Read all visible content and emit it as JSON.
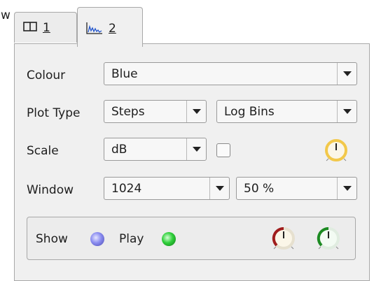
{
  "edge_text": "w",
  "tabs": [
    {
      "label": "1",
      "icon": "split-view-icon"
    },
    {
      "label": "2",
      "icon": "spectrum-icon"
    }
  ],
  "colour": {
    "label": "Colour",
    "value": "Blue"
  },
  "plot_type": {
    "label": "Plot Type",
    "style_value": "Steps",
    "bins_value": "Log Bins"
  },
  "scale": {
    "label": "Scale",
    "value": "dB",
    "checkbox_checked": false
  },
  "window": {
    "label": "Window",
    "size_value": "1024",
    "overlap_value": "50 %"
  },
  "group": {
    "show_label": "Show",
    "play_label": "Play"
  },
  "colors": {
    "show_led": "#8a8cf0",
    "play_led": "#2fcf3a",
    "gain_knob": "#f2c84a",
    "knob_red": "#a01c1c",
    "knob_green": "#1c8a22"
  },
  "icons": {
    "gain": "gain-knob-icon",
    "threshold": "threshold-knob-icon",
    "level": "level-knob-icon"
  }
}
